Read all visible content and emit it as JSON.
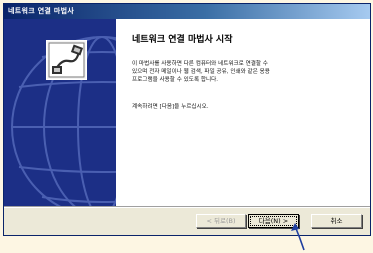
{
  "window": {
    "title": "네트워크 연결 마법사"
  },
  "main": {
    "heading": "네트워크 연결 마법사 시작",
    "paragraph1": "이 마법사를 사용하면 다른 컴퓨터와 네트워크로 연결할 수\n있으며 전자 메일이나 웹 검색, 파일 공유, 인쇄와 같은 응용\n프로그램을 사용할 수 있도록 합니다.",
    "paragraph2": "계속하려면 [다음]을 누르십시오."
  },
  "buttons": {
    "back": "< 뒤로(B)",
    "next": "다음(N) >",
    "cancel": "취소"
  },
  "colors": {
    "banner": "#1c2f86",
    "titlebar": "#0a246a",
    "pointer": "#1f3fa0"
  },
  "icons": {
    "logo": "network-cable-icon",
    "annotation": "arrow-pointer-icon"
  }
}
